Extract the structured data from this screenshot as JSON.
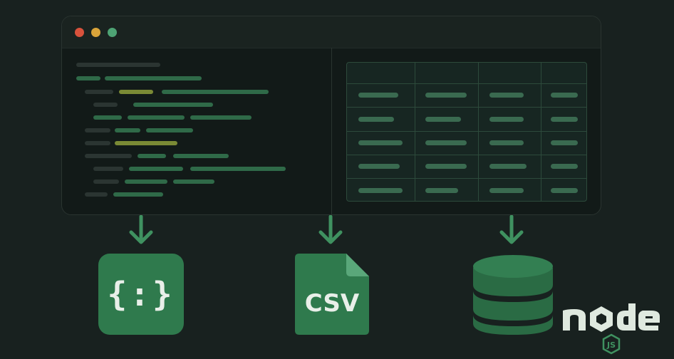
{
  "window": {
    "controls": [
      "close",
      "minimize",
      "maximize"
    ]
  },
  "icons": {
    "json": {
      "name": "json-icon",
      "glyph": "{:}"
    },
    "csv": {
      "name": "csv-file-icon",
      "label": "CSV"
    },
    "database": {
      "name": "database-icon"
    },
    "node": {
      "name": "nodejs-logo",
      "wordmark": "node",
      "badge": "JS"
    }
  },
  "colors": {
    "background": "#18211f",
    "accent": "#2f7a4d",
    "window": "#121a18",
    "highlight": "#7a8a35"
  }
}
